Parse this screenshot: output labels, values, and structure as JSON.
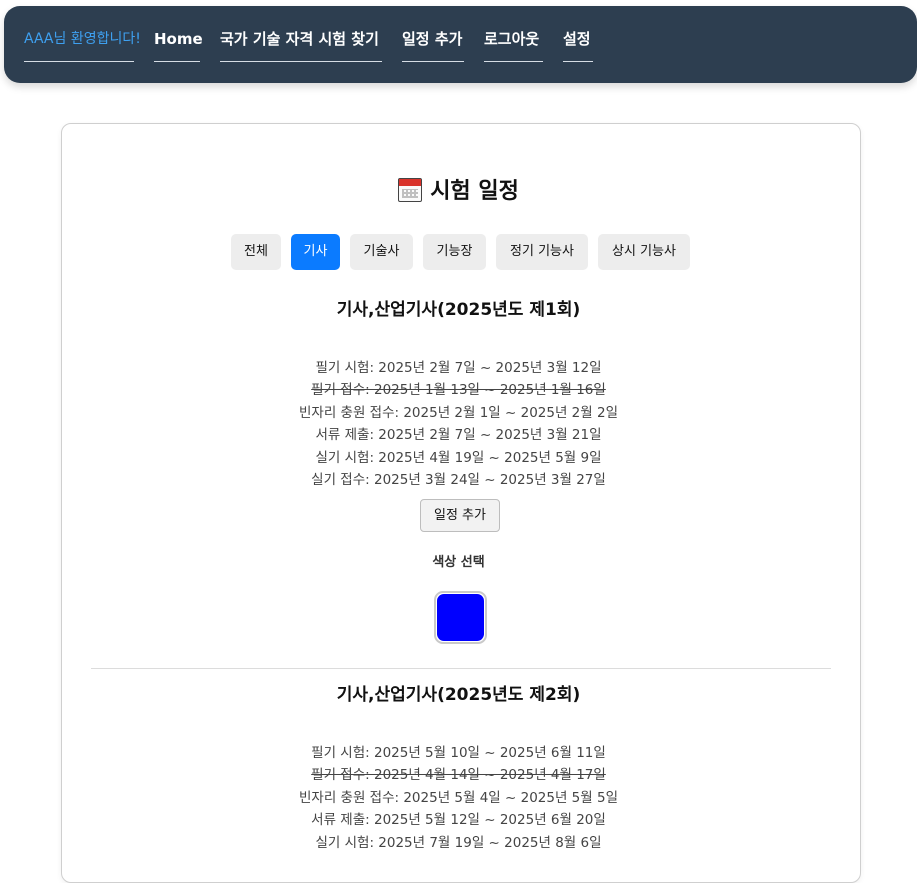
{
  "nav": {
    "welcome": "AAA님 환영합니다!",
    "items": [
      "Home",
      "국가 기술 자격 시험 찾기",
      "일정 추가",
      "로그아웃",
      "설정"
    ]
  },
  "page": {
    "title": "시험 일정",
    "title_icon": "calendar-icon"
  },
  "tabs": {
    "items": [
      "전체",
      "기사",
      "기술사",
      "기능장",
      "정기 기능사",
      "상시 기능사"
    ],
    "active": "기사"
  },
  "exams": [
    {
      "title": "기사,산업기사(2025년도 제1회)",
      "lines": [
        "필기 시험: 2025년 2월 7일 ~ 2025년 3월 12일",
        "필기 접수: 2025년 1월 13일 ~ 2025년 1월 16일",
        "빈자리 충원 접수: 2025년 2월 1일 ~ 2025년 2월 2일",
        "서류 제출: 2025년 2월 7일 ~ 2025년 3월 21일",
        "실기 시험: 2025년 4월 19일 ~ 2025년 5월 9일",
        "실기 접수: 2025년 3월 24일 ~ 2025년 3월 27일"
      ],
      "strikethrough_line": 1,
      "add_button": "일정 추가",
      "color_label": "색상 선택",
      "selected_color": "#0000ff"
    },
    {
      "title": "기사,산업기사(2025년도 제2회)",
      "lines": [
        "필기 시험: 2025년 5월 10일 ~ 2025년 6월 11일",
        "필기 접수: 2025년 4월 14일 ~ 2025년 4월 17일",
        "빈자리 충원 접수: 2025년 5월 4일 ~ 2025년 5월 5일",
        "서류 제출: 2025년 5월 12일 ~ 2025년 6월 20일",
        "실기 시험: 2025년 7월 19일 ~ 2025년 8월 6일"
      ],
      "strikethrough_line": 1
    }
  ],
  "colors": {
    "navbar": "#2d3e50",
    "welcome_text": "#3ea0f0",
    "active_tab": "#0b7bff",
    "tab": "#ededed"
  }
}
